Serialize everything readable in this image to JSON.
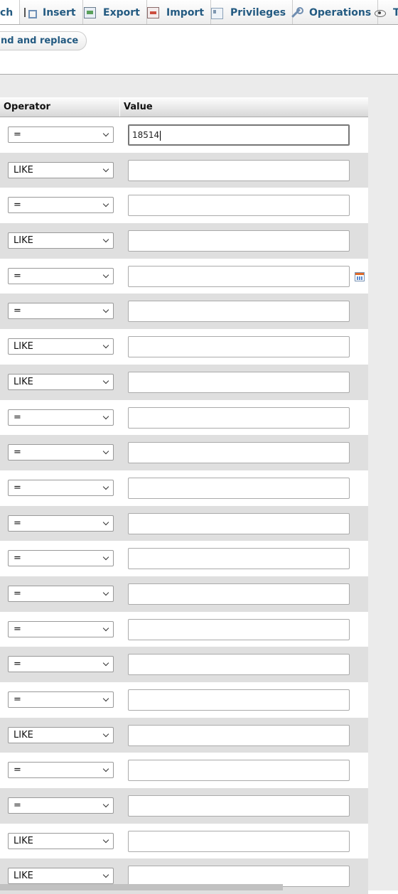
{
  "tabs": [
    {
      "label": "ch",
      "icon": "search-icon",
      "active": true
    },
    {
      "label": "Insert",
      "icon": "insert-icon"
    },
    {
      "label": "Export",
      "icon": "export-icon"
    },
    {
      "label": "Import",
      "icon": "import-icon"
    },
    {
      "label": "Privileges",
      "icon": "privileges-icon"
    },
    {
      "label": "Operations",
      "icon": "operations-icon"
    },
    {
      "label": "T",
      "icon": "eye-icon"
    }
  ],
  "subnav": {
    "find_replace": "nd and replace"
  },
  "table": {
    "header": {
      "operator": "Operator",
      "value": "Value"
    },
    "rows": [
      {
        "operator": "=",
        "value": "18514"
      },
      {
        "operator": "LIKE",
        "value": ""
      },
      {
        "operator": "=",
        "value": ""
      },
      {
        "operator": "LIKE",
        "value": ""
      },
      {
        "operator": "=",
        "value": ""
      },
      {
        "operator": "=",
        "value": ""
      },
      {
        "operator": "LIKE",
        "value": ""
      },
      {
        "operator": "LIKE",
        "value": ""
      },
      {
        "operator": "=",
        "value": ""
      },
      {
        "operator": "=",
        "value": ""
      },
      {
        "operator": "=",
        "value": ""
      },
      {
        "operator": "=",
        "value": ""
      },
      {
        "operator": "=",
        "value": ""
      },
      {
        "operator": "=",
        "value": ""
      },
      {
        "operator": "=",
        "value": ""
      },
      {
        "operator": "=",
        "value": ""
      },
      {
        "operator": "=",
        "value": ""
      },
      {
        "operator": "LIKE",
        "value": ""
      },
      {
        "operator": "=",
        "value": ""
      },
      {
        "operator": "=",
        "value": ""
      },
      {
        "operator": "LIKE",
        "value": ""
      },
      {
        "operator": "LIKE",
        "value": ""
      }
    ]
  }
}
